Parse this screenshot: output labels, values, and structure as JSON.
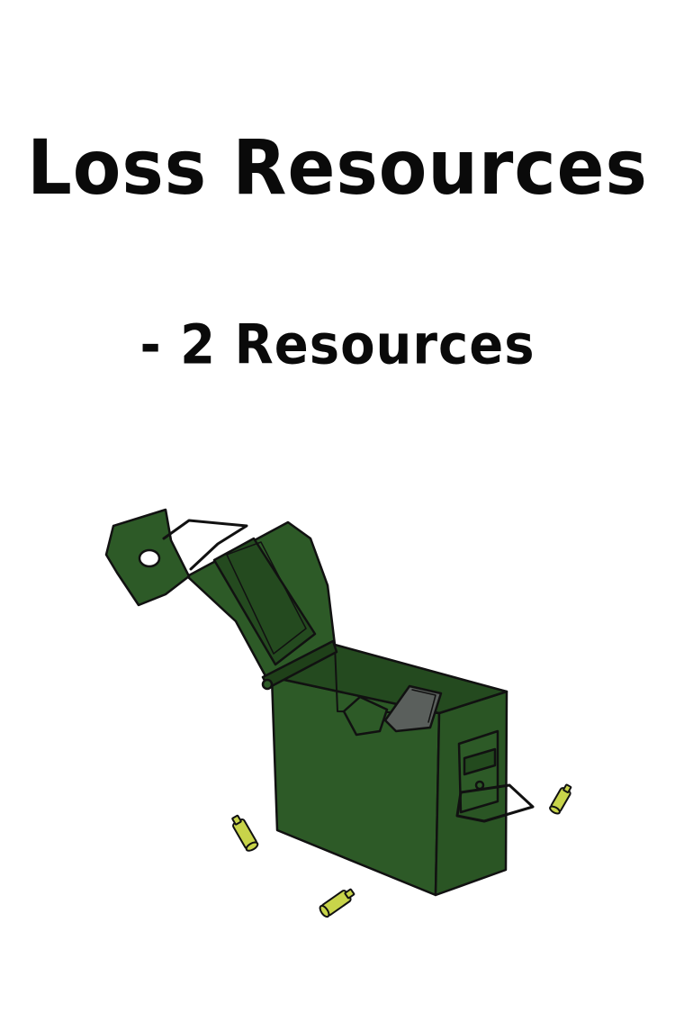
{
  "card": {
    "title": "Loss Resources",
    "effect": "- 2 Resources",
    "illustration": "open-ammo-box-illustration",
    "colors": {
      "box_green": "#2d5a27",
      "box_dark": "#1f4019",
      "shell_yellow": "#c8d44a",
      "outline": "#111111"
    }
  }
}
